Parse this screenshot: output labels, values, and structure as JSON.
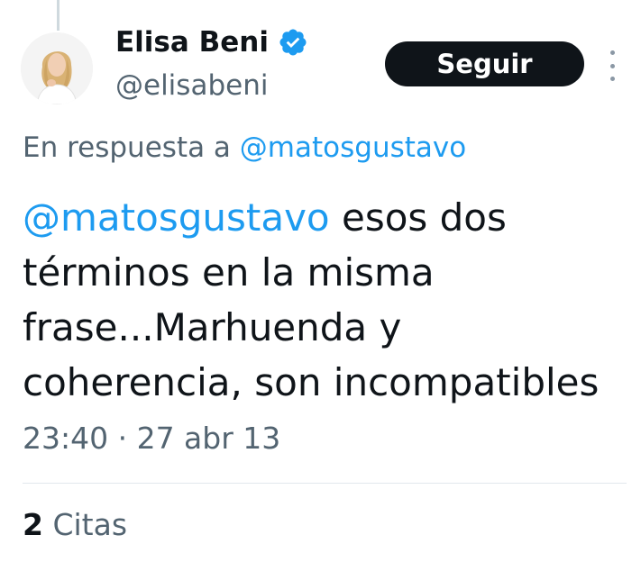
{
  "author": {
    "display_name": "Elisa Beni",
    "handle": "@elisabeni",
    "verified_icon": "verified-badge-icon",
    "verified_color": "#1d9bf0"
  },
  "follow_button": {
    "label": "Seguir"
  },
  "reply_to": {
    "prefix": "En respuesta a",
    "handle": "@matosgustavo"
  },
  "tweet": {
    "mention": "@matosgustavo",
    "line1_rest": " esos dos",
    "line2": "términos en la misma",
    "line3": "frase...Marhuenda y",
    "line4": "coherencia, son incompatibles"
  },
  "timestamp": "23:40 · 27 abr 13",
  "stats": {
    "quotes_count": "2",
    "quotes_label": "Citas"
  },
  "colors": {
    "link": "#1d9bf0",
    "secondary_text": "#536471",
    "primary_text": "#0f1419",
    "button_bg": "#0f1419"
  }
}
